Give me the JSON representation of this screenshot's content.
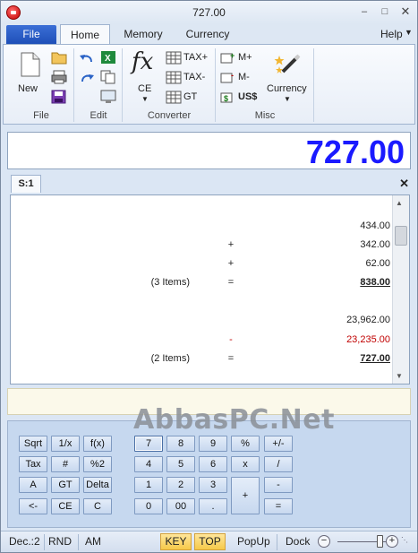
{
  "window": {
    "title": "727.00"
  },
  "tabs": {
    "file": "File",
    "home": "Home",
    "memory": "Memory",
    "currency": "Currency",
    "help": "Help"
  },
  "ribbon": {
    "new": "New",
    "ce": "CE",
    "tax_plus": "TAX+",
    "tax_minus": "TAX-",
    "gt": "GT",
    "m_plus": "M+",
    "m_minus": "M-",
    "us_dollar": "US$",
    "currency": "Currency",
    "groups": {
      "file": "File",
      "edit": "Edit",
      "converter": "Converter",
      "misc": "Misc"
    }
  },
  "display": {
    "value": "727.00"
  },
  "tape_tab": {
    "label": "S:1"
  },
  "tape": [
    {
      "label": "",
      "op": "",
      "value": "434.00",
      "style": ""
    },
    {
      "label": "",
      "op": "+",
      "value": "342.00",
      "style": ""
    },
    {
      "label": "",
      "op": "+",
      "value": "62.00",
      "style": ""
    },
    {
      "label": "(3 Items)",
      "op": "=",
      "value": "838.00",
      "style": "total"
    },
    {
      "label": "",
      "op": "",
      "value": "23,962.00",
      "style": ""
    },
    {
      "label": "",
      "op": "-",
      "value": "23,235.00",
      "style": "red"
    },
    {
      "label": "(2 Items)",
      "op": "=",
      "value": "727.00",
      "style": "total"
    }
  ],
  "watermark": "AbbasPC.Net",
  "keys": {
    "sqrt": "Sqrt",
    "reciprocal": "1/x",
    "fx": "f(x)",
    "tax": "Tax",
    "hash": "#",
    "pct2": "%2",
    "a": "A",
    "gt": "GT",
    "delta": "Delta",
    "back": "<-",
    "ce": "CE",
    "c": "C",
    "k7": "7",
    "k8": "8",
    "k9": "9",
    "pct": "%",
    "plusminus": "+/-",
    "k4": "4",
    "k5": "5",
    "k6": "6",
    "mul": "x",
    "div": "/",
    "k1": "1",
    "k2": "2",
    "k3": "3",
    "plus": "+",
    "minus": "-",
    "k0": "0",
    "k00": "00",
    "dot": ".",
    "eq": "="
  },
  "status": {
    "dec": "Dec.:2",
    "rnd": "RND",
    "am": "AM",
    "key": "KEY",
    "top": "TOP",
    "popup": "PopUp",
    "dock": "Dock"
  },
  "colors": {
    "display_text": "#1a1aff",
    "negative": "#c00000",
    "file_tab": "#1e4fb8",
    "highlight": "#f6c94a"
  }
}
